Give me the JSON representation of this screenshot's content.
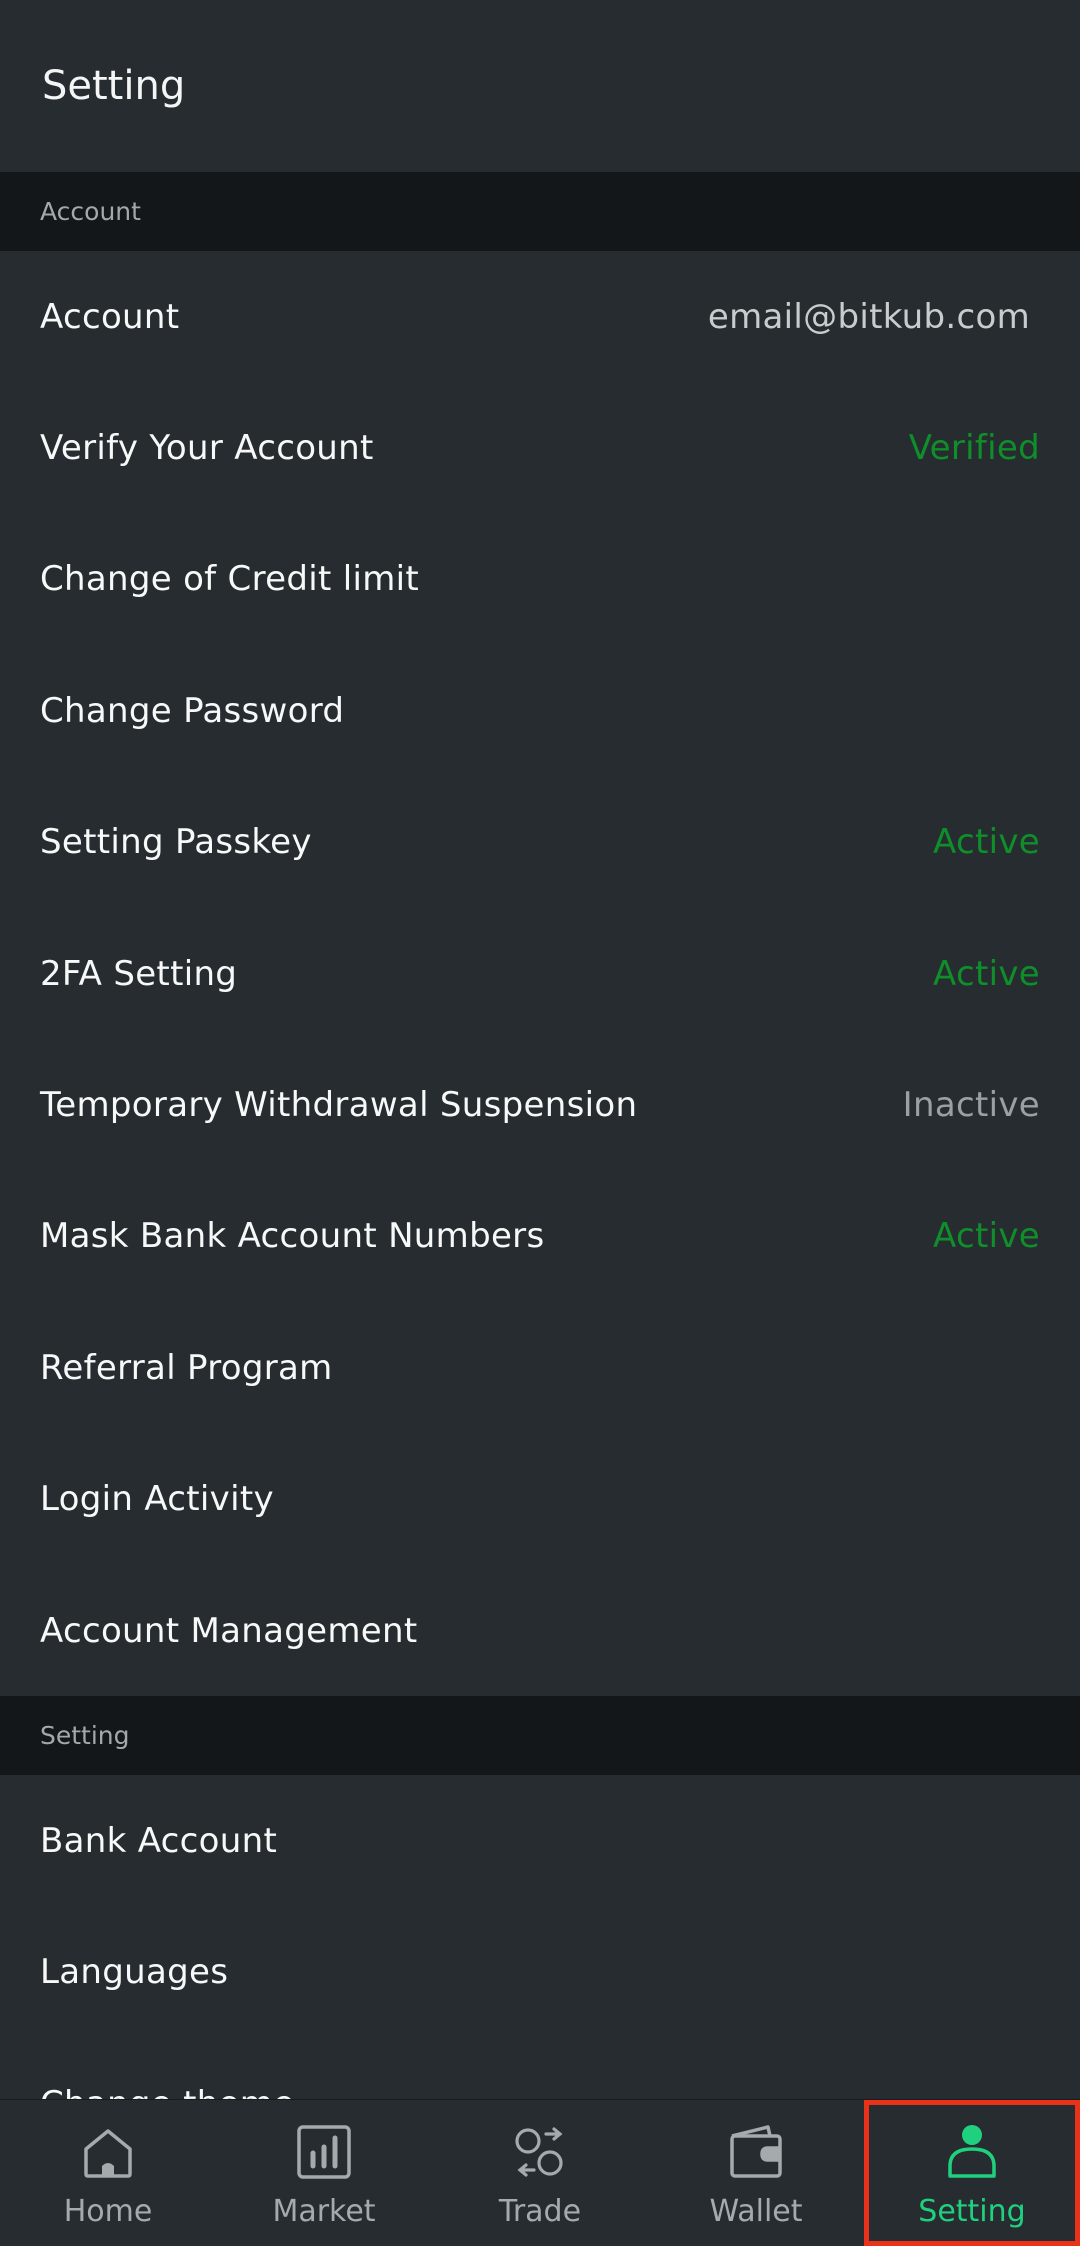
{
  "header": {
    "title": "Setting"
  },
  "sections": {
    "account": {
      "title": "Account",
      "rows": [
        {
          "label": "Account",
          "value": "email@bitkub.com"
        },
        {
          "label": "Verify Your Account",
          "value": "Verified"
        },
        {
          "label": "Change of Credit limit",
          "value": ""
        },
        {
          "label": "Change Password",
          "value": ""
        },
        {
          "label": "Setting Passkey",
          "value": "Active"
        },
        {
          "label": "2FA Setting",
          "value": "Active"
        },
        {
          "label": "Temporary Withdrawal Suspension",
          "value": "Inactive"
        },
        {
          "label": "Mask Bank Account Numbers",
          "value": "Active"
        },
        {
          "label": "Referral Program",
          "value": ""
        },
        {
          "label": "Login Activity",
          "value": ""
        },
        {
          "label": "Account Management",
          "value": ""
        }
      ]
    },
    "setting": {
      "title": "Setting",
      "rows": [
        {
          "label": "Bank Account",
          "value": ""
        },
        {
          "label": "Languages",
          "value": ""
        },
        {
          "label": "Change theme",
          "value": ""
        }
      ]
    }
  },
  "bottom_nav": [
    {
      "label": "Home",
      "icon": "home-icon"
    },
    {
      "label": "Market",
      "icon": "chart-icon"
    },
    {
      "label": "Trade",
      "icon": "trade-icon"
    },
    {
      "label": "Wallet",
      "icon": "wallet-icon"
    },
    {
      "label": "Setting",
      "icon": "user-icon",
      "active": true
    }
  ],
  "colors": {
    "background": "#262c30",
    "section_bg": "#131719",
    "status_green": "#0f8f2a",
    "status_gray": "#9ba0a3",
    "active_nav": "#1fd17f",
    "highlight_border": "#e8321a"
  }
}
